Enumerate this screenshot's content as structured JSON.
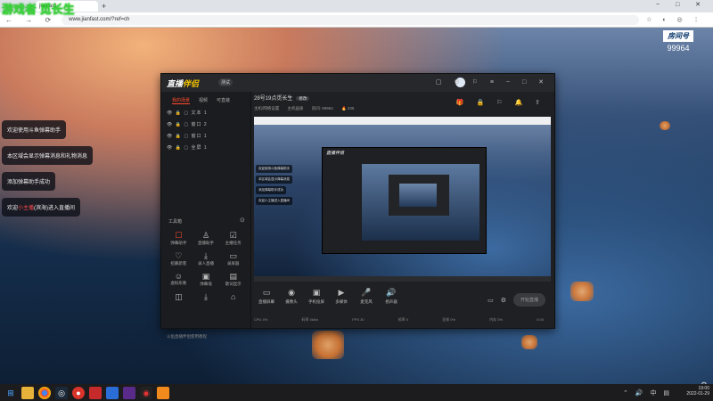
{
  "watermark": "游戏者 觅长生",
  "browser": {
    "tab_title": "jianfast",
    "new_tab": "+",
    "url": "www.jianfast.com/?ref=ch",
    "window_controls": "− □ ✕"
  },
  "room": {
    "label": "房间号",
    "number": "99964"
  },
  "chat_messages": [
    {
      "text": "欢迎使用斗鱼弹幕助手",
      "highlight": ""
    },
    {
      "text": "本区域会显示弹幕消息和礼物消息",
      "highlight": ""
    },
    {
      "text": "添加弹幕助手成功",
      "highlight": ""
    },
    {
      "prefix": "欢迎",
      "highlight": "小主播",
      "suffix": "(滨海)进入直播间"
    }
  ],
  "app": {
    "logo_left": "直播",
    "logo_right": "伴侣",
    "version": "测试",
    "tabs": [
      "我的场景",
      "视频",
      "可直装"
    ],
    "sources": [
      "👁 🔒 ▢ 文本 1",
      "👁 🔒 ▢ 窗口 2",
      "👁 🔒 ▢ 窗口 1",
      "👁 🔒 ▢ 全屏 1"
    ],
    "tools_title": "工具箱",
    "tools": [
      {
        "icon": "☐",
        "label": "弹幕助手",
        "active": true
      },
      {
        "icon": "♙",
        "label": "直播助手",
        "active": false
      },
      {
        "icon": "☑",
        "label": "主播任务",
        "active": false
      },
      {
        "icon": "♡",
        "label": "招募新客",
        "active": false
      },
      {
        "icon": "⤓",
        "label": "录人直播",
        "active": false
      },
      {
        "icon": "▭",
        "label": "录屏器",
        "active": false
      },
      {
        "icon": "☺",
        "label": "虚拟形象",
        "active": false
      },
      {
        "icon": "▣",
        "label": "弹幕墙",
        "active": false
      },
      {
        "icon": "▤",
        "label": "歌词显示",
        "active": false
      },
      {
        "icon": "◫",
        "label": "",
        "active": false
      },
      {
        "icon": "⤓",
        "label": "",
        "active": false
      },
      {
        "icon": "⌂",
        "label": "",
        "active": false
      }
    ],
    "footer": "斗鱼直播伴侣使用教程",
    "stream_title": "28号19点觅长生",
    "stream_badge": "修改",
    "meta": [
      "主机/网络设置",
      "主机画质",
      "房间: 99964",
      "🔥 235"
    ],
    "bottom_tools": [
      {
        "icon": "▭",
        "label": "直播屏幕"
      },
      {
        "icon": "◉",
        "label": "摄像头"
      },
      {
        "icon": "▣",
        "label": "手机投屏"
      },
      {
        "icon": "▶",
        "label": "多媒体"
      },
      {
        "icon": "🎤",
        "label": "麦克风"
      },
      {
        "icon": "🔊",
        "label": "扬声器"
      }
    ],
    "start_button": "开始直播",
    "status": [
      "CPU 4%",
      "码率 0kb/s",
      "FPS 30",
      "帧率 0",
      "丢帧 0%",
      "内存 3%",
      "0:00"
    ]
  },
  "preview": {
    "chat": [
      "欢迎使用斗鱼弹幕助手",
      "本区域会显示弹幕消息",
      "添加弹幕助手成功",
      "欢迎小主播进入直播间"
    ],
    "nested_logo": "直播伴侣"
  },
  "taskbar": {
    "time": "19:00",
    "date": "2022-01-29",
    "tray_icons": "⌃ 🔊 中 ▤"
  }
}
